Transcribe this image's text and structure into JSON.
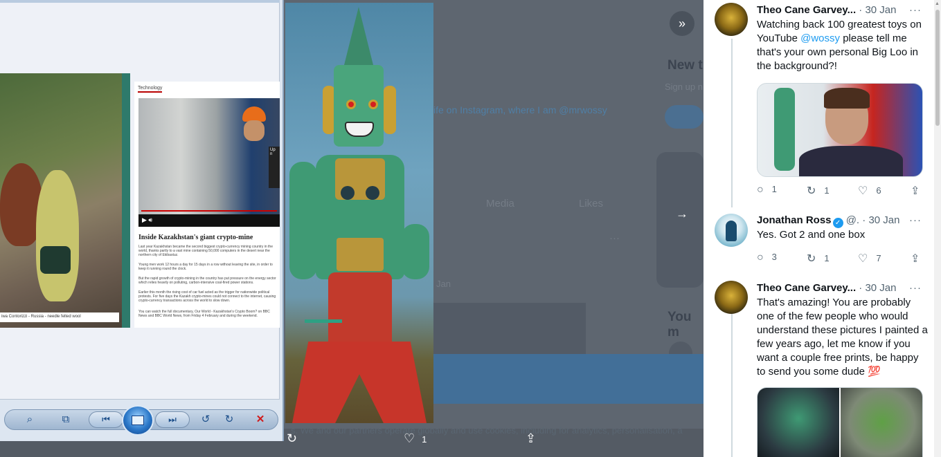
{
  "background_page": {
    "ghost_heading_new": "New t",
    "ghost_signup": "Sign up n",
    "ghost_bio": "ife on Instagram, where I am @mrwossy",
    "ghost_tab_media": "Media",
    "ghost_tab_likes": "Likes",
    "ghost_date": "Jan",
    "ghost_you_might": "You m",
    "ghost_cookie": "s. We and our partners operate globally and use cookies, including for analytics, personalisation, a"
  },
  "viewer": {
    "caption": "iwa Contorizzi - Russia - needle felted wool",
    "article": {
      "section": "Technology",
      "headline": "Inside Kazakhstan's giant crypto-mine",
      "paragraphs": [
        "Last year Kazakhstan became the second biggest crypto-currency mining country in the world, thanks partly to a vast mine containing 50,000 computers in the desert near the northern city of Ekibastuz.",
        "Young men work 12 hours a day for 15 days in a row without leaving the site, in order to keep it running round the clock.",
        "But the rapid growth of crypto-mining in the country has put pressure on the energy sector which relies heavily on polluting, carbon-intensive coal-fired power stations.",
        "Earlier this month the rising cost of car fuel acted as the trigger for nationwide political protests. For five days the Kazakh crypto-mines could not connect to the internet, causing crypto-currency transactions across the world to slow down.",
        "You can watch the full documentary, Our World - Kazakhstan's Crypto Boom? on BBC News and BBC World News, from Friday 4 February and during the weekend."
      ],
      "video_badge": "Up n"
    },
    "toolbar": {
      "zoom_icon": "⌕",
      "fit_icon": "⧉",
      "prev_icon": "⏮",
      "next_icon": "⏭",
      "rotate_ccw_icon": "↺",
      "rotate_cw_icon": "↻",
      "delete_icon": "✕"
    }
  },
  "media_viewer": {
    "prev_icon": "»",
    "next_icon": "→",
    "bottom_actions": {
      "retweet_icon": "↻",
      "like_icon": "♡",
      "like_count": "1",
      "share_icon": "⇪"
    }
  },
  "replies": [
    {
      "name": "Theo Cane Garvey...",
      "handle": "",
      "date": "· 30 Jan",
      "text_pre": "Watching back 100 greatest toys on YouTube ",
      "mention": "@wossy",
      "text_post": " please tell me that's your  own personal Big Loo in the background?!",
      "counts": {
        "reply": "1",
        "retweet": "1",
        "like": "6"
      }
    },
    {
      "name": "Jonathan Ross",
      "handle": "@.",
      "date": "· 30 Jan",
      "text": "Yes. Got 2 and one box",
      "counts": {
        "reply": "3",
        "retweet": "1",
        "like": "7"
      }
    },
    {
      "name": "Theo Cane Garvey...",
      "handle": "",
      "date": "· 30 Jan",
      "text": "That's amazing! You are probably one of the few people who would understand these pictures I painted a few years ago, let me know if you want a couple free prints, be happy to send you some dude 💯"
    }
  ],
  "icons": {
    "more": "···",
    "reply": "○",
    "retweet": "↻",
    "like": "♡",
    "share": "⇪",
    "verified": "✓"
  },
  "colors": {
    "link": "#1d9bf0",
    "text": "#0f1419",
    "muted": "#536471"
  }
}
